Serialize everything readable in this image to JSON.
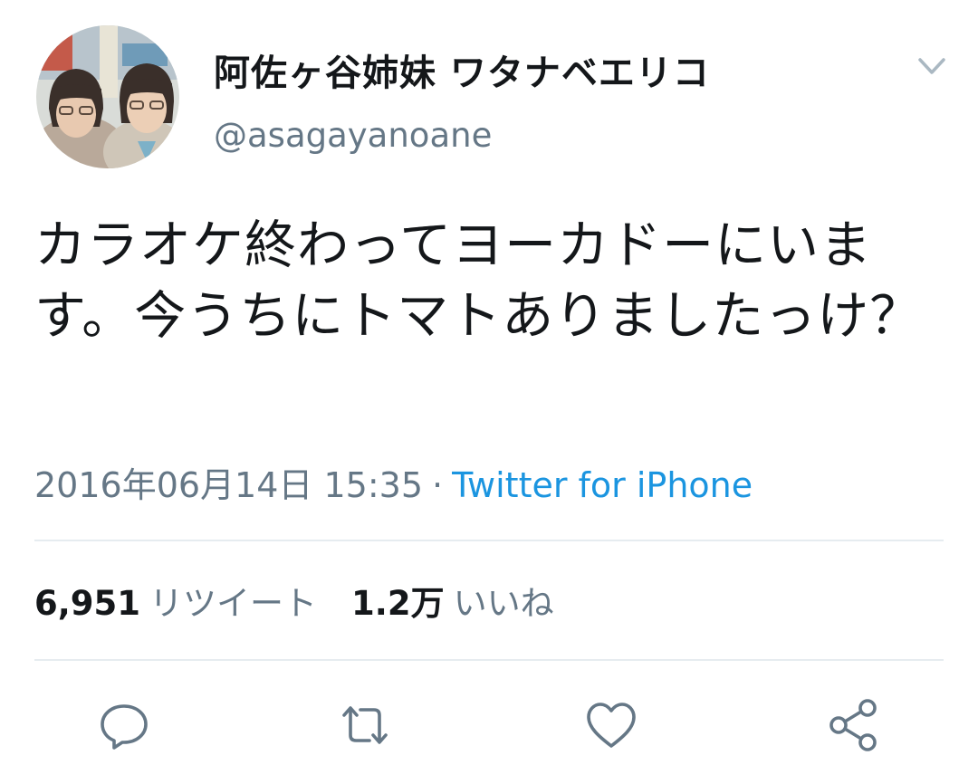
{
  "user": {
    "display_name": "阿佐ヶ谷姉妹 ワタナベエリコ",
    "handle": "@asagayanoane"
  },
  "tweet": {
    "text": "カラオケ終わってヨーカドーにいます。今うちにトマトありましたっけ？",
    "timestamp": "2016年06月14日 15:35",
    "separator": "·",
    "source": "Twitter for iPhone"
  },
  "stats": {
    "retweets_count": "6,951",
    "retweets_label": "リツイート",
    "likes_count": "1.2万",
    "likes_label": "いいね"
  },
  "actions": [
    "reply-icon",
    "retweet-icon",
    "like-icon",
    "share-icon"
  ],
  "colors": {
    "text": "#14171a",
    "secondary": "#657786",
    "link": "#1b95e0",
    "divider": "#e6ecf0"
  }
}
